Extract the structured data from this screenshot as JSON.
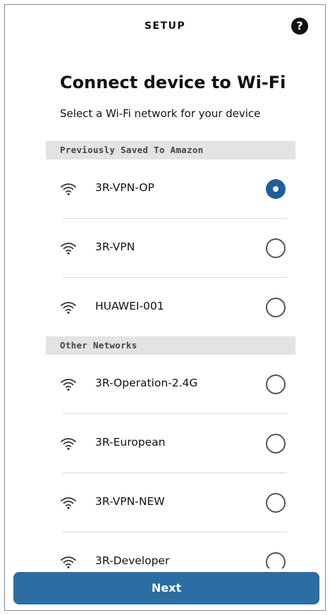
{
  "header": {
    "title": "SETUP",
    "help_icon": "question-circle-icon",
    "help_glyph": "?"
  },
  "main": {
    "heading": "Connect device to Wi-Fi",
    "subheading": "Select a Wi-Fi network for your device"
  },
  "sections": {
    "saved_label": "Previously Saved To Amazon",
    "other_label": "Other Networks"
  },
  "networks": {
    "saved": [
      {
        "name": "3R-VPN-OP",
        "selected": true
      },
      {
        "name": "3R-VPN",
        "selected": false
      },
      {
        "name": "HUAWEI-001",
        "selected": false
      }
    ],
    "other": [
      {
        "name": "3R-Operation-2.4G",
        "selected": false
      },
      {
        "name": "3R-European",
        "selected": false
      },
      {
        "name": "3R-VPN-NEW",
        "selected": false
      },
      {
        "name": "3R-Developer",
        "selected": false
      }
    ]
  },
  "footer": {
    "next_label": "Next"
  },
  "colors": {
    "accent": "#2b6ea3",
    "radio_selected": "#1f5f99",
    "section_bg": "#e3e3e3"
  }
}
